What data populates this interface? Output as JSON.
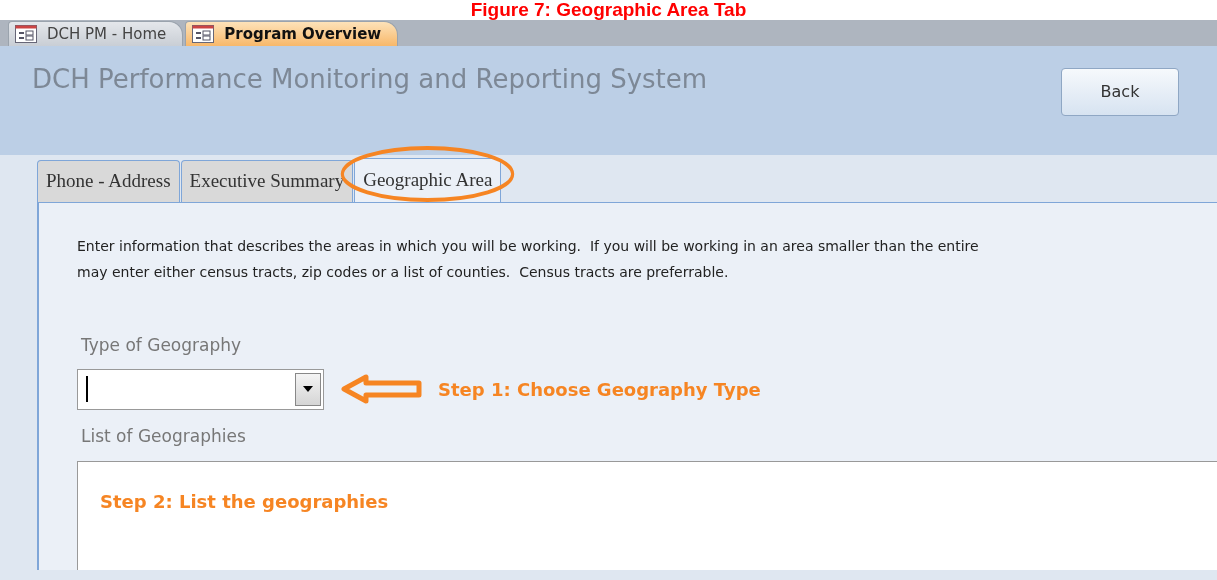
{
  "caption": "Figure 7: Geographic Area Tab",
  "document_tabs": [
    {
      "label": "DCH PM - Home",
      "selected": false
    },
    {
      "label": "Program Overview",
      "selected": true
    }
  ],
  "header": {
    "title": "DCH Performance Monitoring and Reporting System",
    "back_button": "Back"
  },
  "form_tabs": [
    {
      "label": "Phone - Address",
      "selected": false
    },
    {
      "label": "Executive Summary",
      "selected": false
    },
    {
      "label": "Geographic Area",
      "selected": true
    }
  ],
  "description_lines": [
    "Enter information that describes the areas in which you will be working.  If you will be working in an area smaller than the entire",
    "may enter either census tracts, zip codes or a list of counties.  Census tracts are preferrable."
  ],
  "type_of_geography": {
    "label": "Type of Geography",
    "annotation": "Step 1: Choose Geography Type"
  },
  "list_of_geographies": {
    "label": "List of Geographies",
    "annotation": "Step 2: List the geographies"
  }
}
